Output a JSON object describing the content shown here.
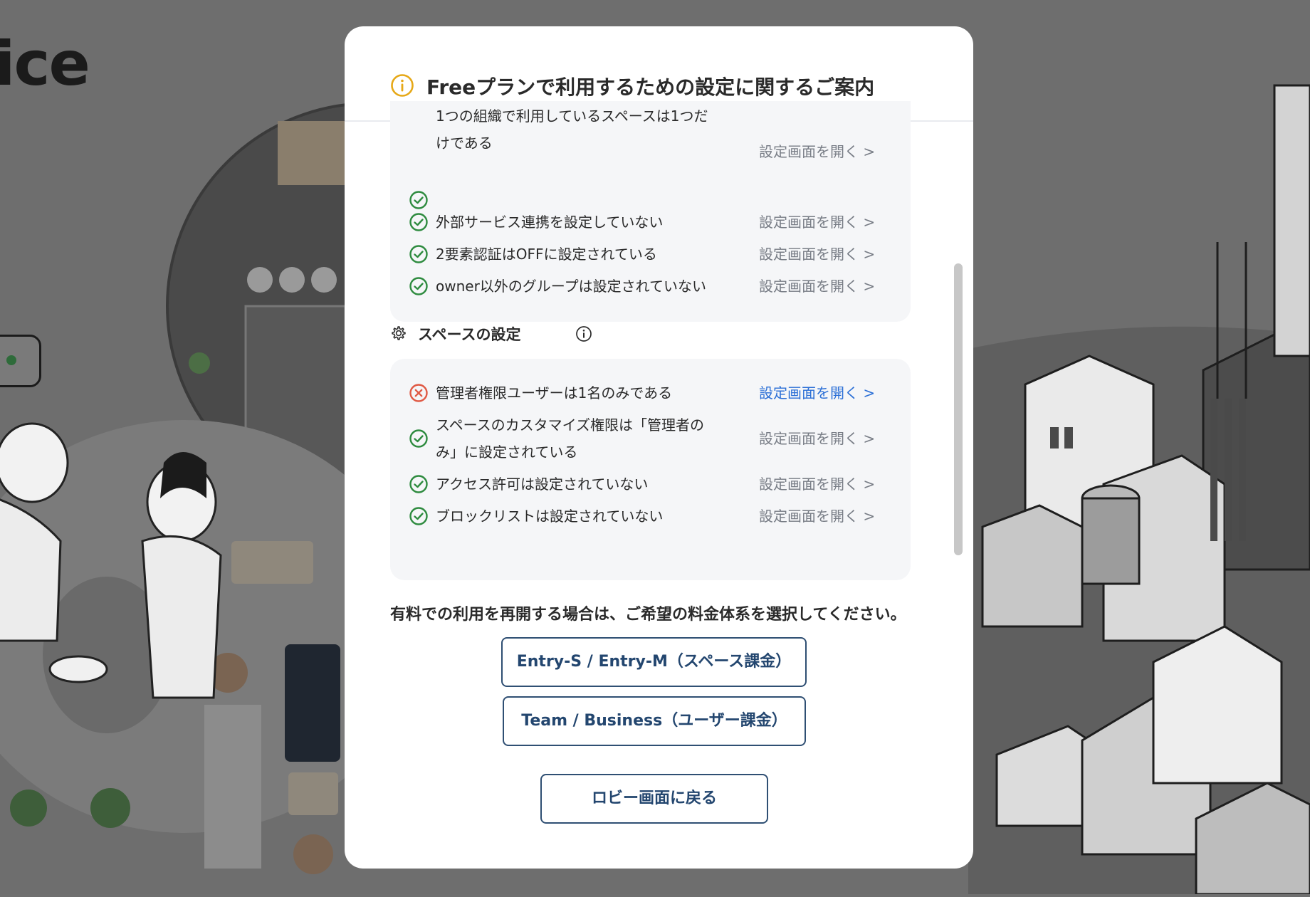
{
  "background": {
    "logo_text": "ice"
  },
  "modal": {
    "title": "Freeプランで利用するための設定に関するご案内",
    "organization_rows": [
      {
        "status": "ok",
        "text": "1つの組織で利用しているスペースは1つだけである",
        "link": "設定画面を開く >"
      },
      {
        "status": "ok",
        "text": "外部サービス連携を設定していない",
        "link": "設定画面を開く >"
      },
      {
        "status": "ok",
        "text": "2要素認証はOFFに設定されている",
        "link": "設定画面を開く >"
      },
      {
        "status": "ok",
        "text": "owner以外のグループは設定されていない",
        "link": "設定画面を開く >"
      }
    ],
    "space_section": {
      "title": "スペースの設定",
      "rows": [
        {
          "status": "error",
          "text": "管理者権限ユーザーは1名のみである",
          "link": "設定画面を開く >"
        },
        {
          "status": "ok",
          "text": "スペースのカスタマイズ権限は「管理者のみ」に設定されている",
          "link": "設定画面を開く >"
        },
        {
          "status": "ok",
          "text": "アクセス許可は設定されていない",
          "link": "設定画面を開く >"
        },
        {
          "status": "ok",
          "text": "ブロックリストは設定されていない",
          "link": "設定画面を開く >"
        }
      ]
    },
    "prompt": "有料での利用を再開する場合は、ご希望の料金体系を選択してください。",
    "buttons": {
      "entry": "Entry-S / Entry-M（スペース課金）",
      "team": "Team / Business（ユーザー課金）",
      "lobby": "ロビー画面に戻る"
    }
  },
  "colors": {
    "ok": "#2e8b3f",
    "error": "#e05a45",
    "info": "#e6a817",
    "link": "#777c85",
    "link_active": "#2b6fd6",
    "button_border": "#2f4f73"
  }
}
